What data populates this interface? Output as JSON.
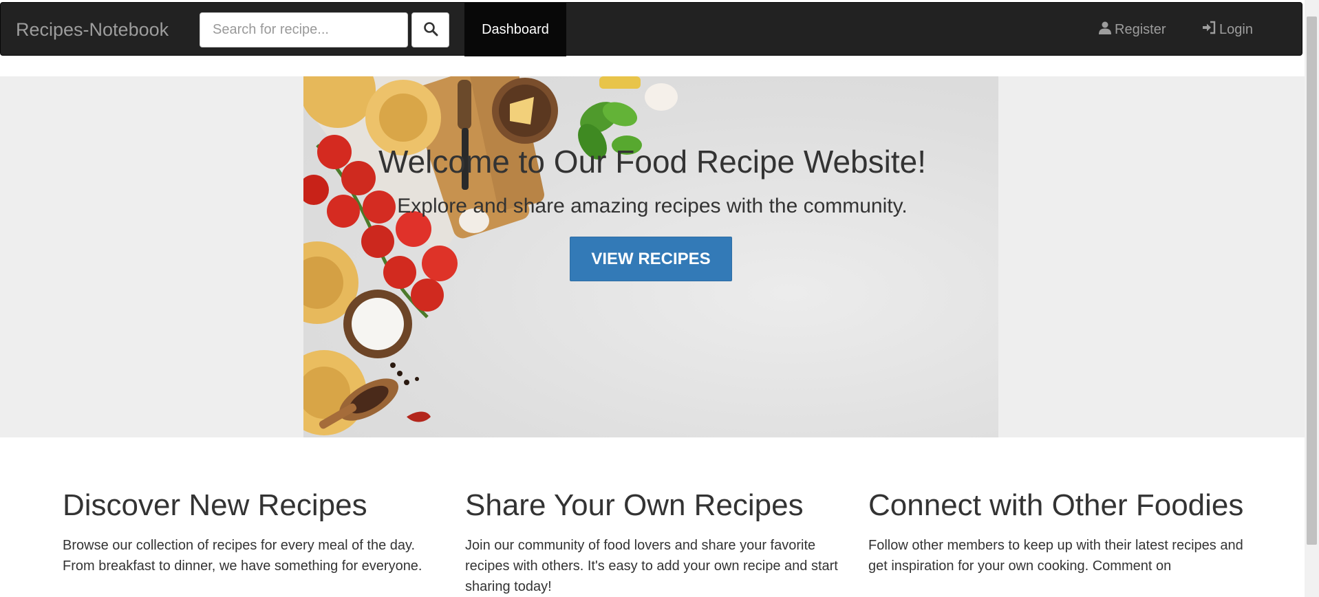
{
  "navbar": {
    "brand": "Recipes-Notebook",
    "search_placeholder": "Search for recipe...",
    "search_icon": "search-icon",
    "dashboard_label": "Dashboard",
    "register_label": "Register",
    "register_icon": "user-icon",
    "login_label": "Login",
    "login_icon": "log-in-icon"
  },
  "hero": {
    "title": "Welcome to Our Food Recipe Website!",
    "subtitle": "Explore and share amazing recipes with the community.",
    "button_label": "VIEW RECIPES"
  },
  "features": [
    {
      "heading": "Discover New Recipes",
      "text": "Browse our collection of recipes for every meal of the day. From breakfast to dinner, we have something for everyone."
    },
    {
      "heading": "Share Your Own Recipes",
      "text": "Join our community of food lovers and share your favorite recipes with others. It's easy to add your own recipe and start sharing today!"
    },
    {
      "heading": "Connect with Other Foodies",
      "text": "Follow other members to keep up with their latest recipes and get inspiration for your own cooking. Comment on"
    }
  ],
  "colors": {
    "navbar_bg": "#222222",
    "navbar_text": "#9d9d9d",
    "active_tab_bg": "#080808",
    "primary_button": "#337ab7",
    "hero_bg": "#eeeeee"
  }
}
